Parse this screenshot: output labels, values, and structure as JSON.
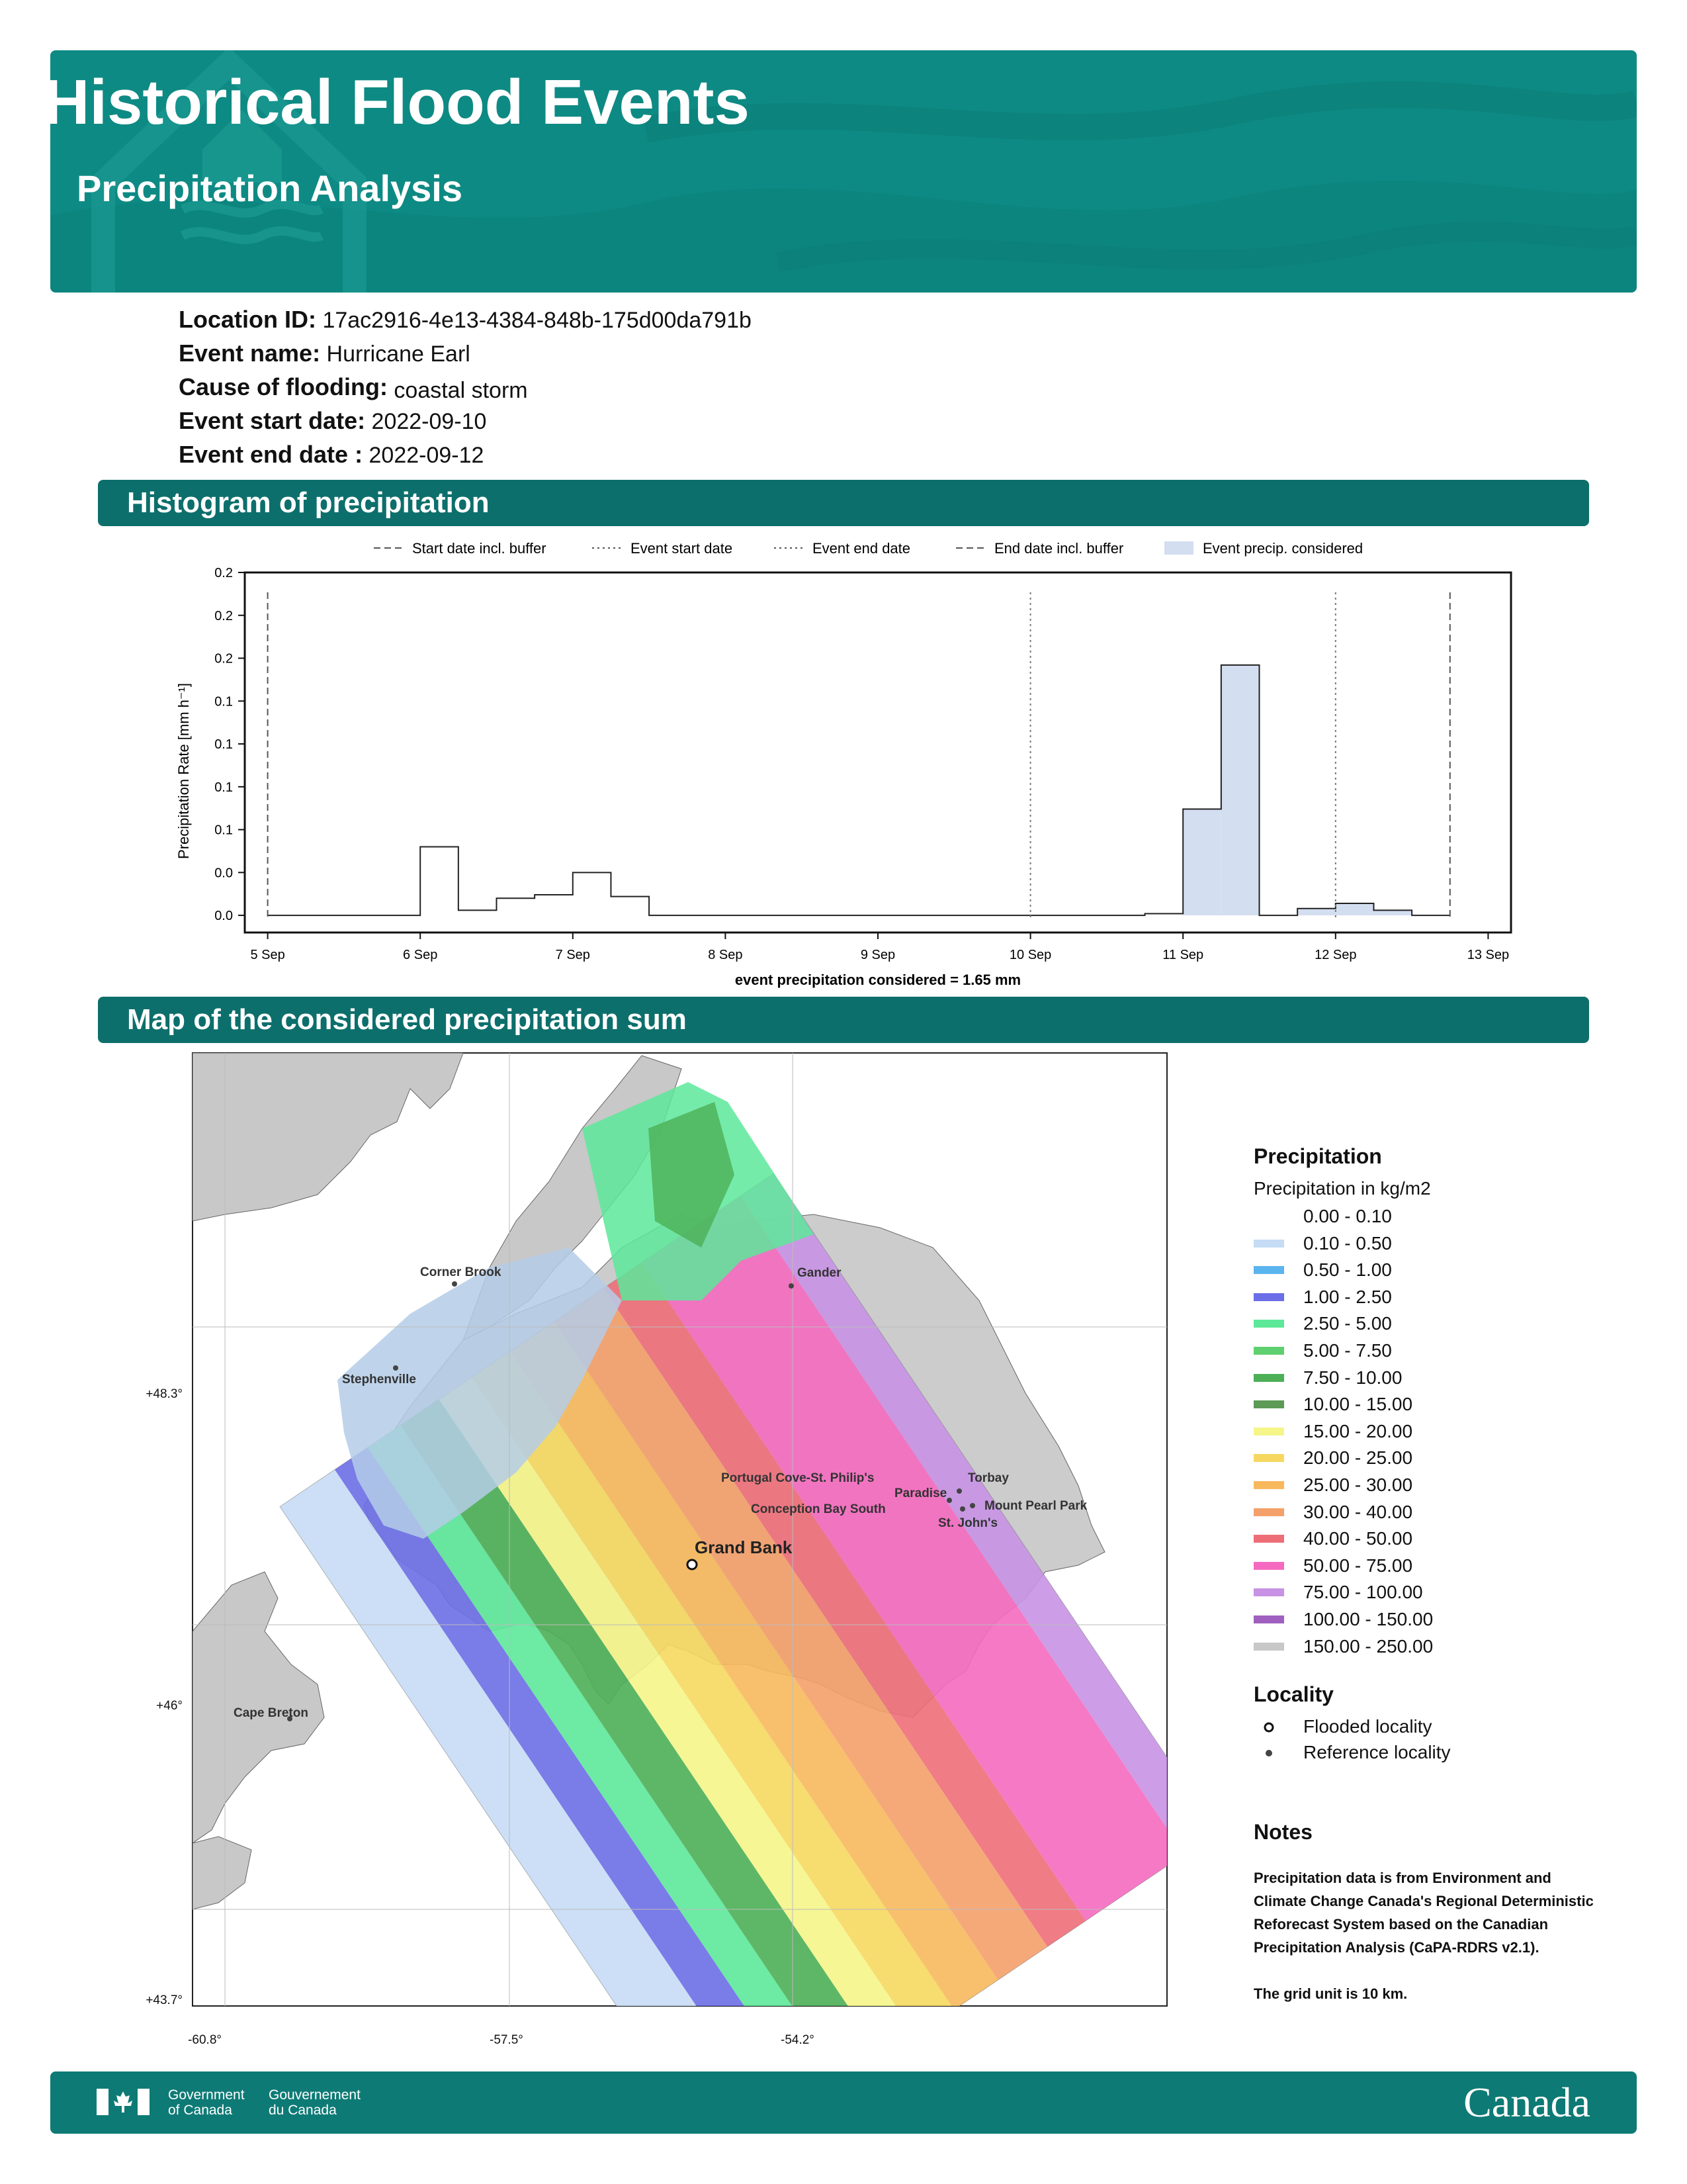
{
  "header": {
    "title": "Historical Flood Events",
    "subtitle": "Precipitation Analysis"
  },
  "event_info": [
    {
      "label": "Location ID:",
      "value": "17ac2916-4e13-4384-848b-175d00da791b"
    },
    {
      "label": "Event name:",
      "value": "Hurricane Earl"
    },
    {
      "label": "Cause of flooding:",
      "value": "coastal storm"
    },
    {
      "label": "Event start date:",
      "value": "2022-09-10"
    },
    {
      "label": "Event end date :",
      "value": "2022-09-12"
    }
  ],
  "sections": {
    "histogram": "Histogram of precipitation",
    "map": "Map of the considered precipitation sum"
  },
  "chart_data": {
    "type": "bar",
    "ylabel": "Precipitation Rate [mm h⁻¹]",
    "xlabel": "event precipitation considered = 1.65 mm",
    "ytick_labels": [
      "0.0",
      "0.0",
      "0.1",
      "0.1",
      "0.1",
      "0.1",
      "0.2",
      "0.2",
      "0.2"
    ],
    "ytick_values": [
      0.0,
      0.025,
      0.05,
      0.075,
      0.1,
      0.125,
      0.15,
      0.175,
      0.2
    ],
    "ylim": [
      -0.01,
      0.2
    ],
    "xlim": [
      -0.15,
      8.15
    ],
    "xtick_labels": [
      "5 Sep",
      "6 Sep",
      "7 Sep",
      "8 Sep",
      "9 Sep",
      "10 Sep",
      "11 Sep",
      "12 Sep",
      "13 Sep"
    ],
    "xtick_values": [
      0,
      1,
      2,
      3,
      4,
      5,
      6,
      7,
      8
    ],
    "legend": [
      {
        "label": "Start date incl. buffer",
        "style": "dashed"
      },
      {
        "label": "Event start date",
        "style": "dotted"
      },
      {
        "label": "Event end date",
        "style": "dotted"
      },
      {
        "label": "End date incl. buffer",
        "style": "dashed"
      },
      {
        "label": "Event precip. considered",
        "style": "patch"
      }
    ],
    "vlines": [
      {
        "x": 0.0,
        "style": "dashed"
      },
      {
        "x": 5.0,
        "style": "dotted"
      },
      {
        "x": 7.0,
        "style": "dotted"
      },
      {
        "x": 7.75,
        "style": "dashed"
      }
    ],
    "bin_width": 0.25,
    "bins_x": [
      0.0,
      0.25,
      0.5,
      0.75,
      1.0,
      1.25,
      1.5,
      1.75,
      2.0,
      2.25,
      2.5,
      2.75,
      3.0,
      3.25,
      3.5,
      3.75,
      4.0,
      4.25,
      4.5,
      4.75,
      5.0,
      5.25,
      5.5,
      5.75,
      6.0,
      6.25,
      6.5,
      6.75,
      7.0,
      7.25,
      7.5
    ],
    "bins_value": [
      0.0,
      0.0,
      0.0,
      0.0,
      0.04,
      0.003,
      0.01,
      0.012,
      0.025,
      0.011,
      0.0,
      0.0,
      0.0,
      0.0,
      0.0,
      0.0,
      0.0,
      0.0,
      0.0,
      0.0,
      0.0,
      0.0,
      0.0,
      0.001,
      0.062,
      0.146,
      0.0,
      0.004,
      0.007,
      0.003,
      0.0
    ],
    "considered_from": 6.0,
    "considered_to": 7.75,
    "colors": {
      "bars": "#d3def0",
      "line": "#222222"
    }
  },
  "map": {
    "lon_labels": [
      "-60.8°",
      "-57.5°",
      "-54.2°"
    ],
    "lat_labels": [
      "+48.3°",
      "+46°",
      "+43.7°"
    ],
    "places": [
      {
        "name": "Corner Brook"
      },
      {
        "name": "Stephenville"
      },
      {
        "name": "Gander"
      },
      {
        "name": "Cape Breton"
      },
      {
        "name": "Portugal Cove-St. Philip's"
      },
      {
        "name": "Torbay"
      },
      {
        "name": "Paradise"
      },
      {
        "name": "Mount Pearl Park"
      },
      {
        "name": "Conception Bay South"
      },
      {
        "name": "St. John's"
      },
      {
        "name": "Grand Bank"
      }
    ]
  },
  "legend": {
    "title": "Precipitation",
    "subtitle": "Precipitation in kg/m2",
    "classes": [
      {
        "label": "0.00 - 0.10",
        "color": "#ffffff"
      },
      {
        "label": "0.10 - 0.50",
        "color": "#c6dcf5"
      },
      {
        "label": "0.50 - 1.00",
        "color": "#5ab4ee"
      },
      {
        "label": "1.00 - 2.50",
        "color": "#6b6ee6"
      },
      {
        "label": "2.50 - 5.00",
        "color": "#5de89a"
      },
      {
        "label": "5.00 - 7.50",
        "color": "#5fd070"
      },
      {
        "label": "7.50 - 10.00",
        "color": "#4caf56"
      },
      {
        "label": "10.00 - 15.00",
        "color": "#5d9a55"
      },
      {
        "label": "15.00 - 20.00",
        "color": "#f5f58a"
      },
      {
        "label": "20.00 - 25.00",
        "color": "#f6d860"
      },
      {
        "label": "25.00 - 30.00",
        "color": "#f7b95c"
      },
      {
        "label": "30.00 - 40.00",
        "color": "#f4a06a"
      },
      {
        "label": "40.00 - 50.00",
        "color": "#ee6e78"
      },
      {
        "label": "50.00 - 75.00",
        "color": "#f56ac0"
      },
      {
        "label": "75.00 - 100.00",
        "color": "#c893e4"
      },
      {
        "label": "100.00 - 150.00",
        "color": "#a060c0"
      },
      {
        "label": "150.00 - 250.00",
        "color": "#c8c8c8"
      }
    ],
    "locality_title": "Locality",
    "flooded_label": "Flooded locality",
    "reference_label": "Reference locality"
  },
  "notes": {
    "title": "Notes",
    "text1": "Precipitation data is from Environment and Climate Change Canada's Regional Deterministic Reforecast System based on the Canadian Precipitation Analysis (CaPA-RDRS v2.1).",
    "text2": "The grid unit is 10 km."
  },
  "footer": {
    "gov_en_1": "Government",
    "gov_en_2": "of Canada",
    "gov_fr_1": "Gouvernement",
    "gov_fr_2": "du Canada",
    "wordmark": "Canada"
  }
}
